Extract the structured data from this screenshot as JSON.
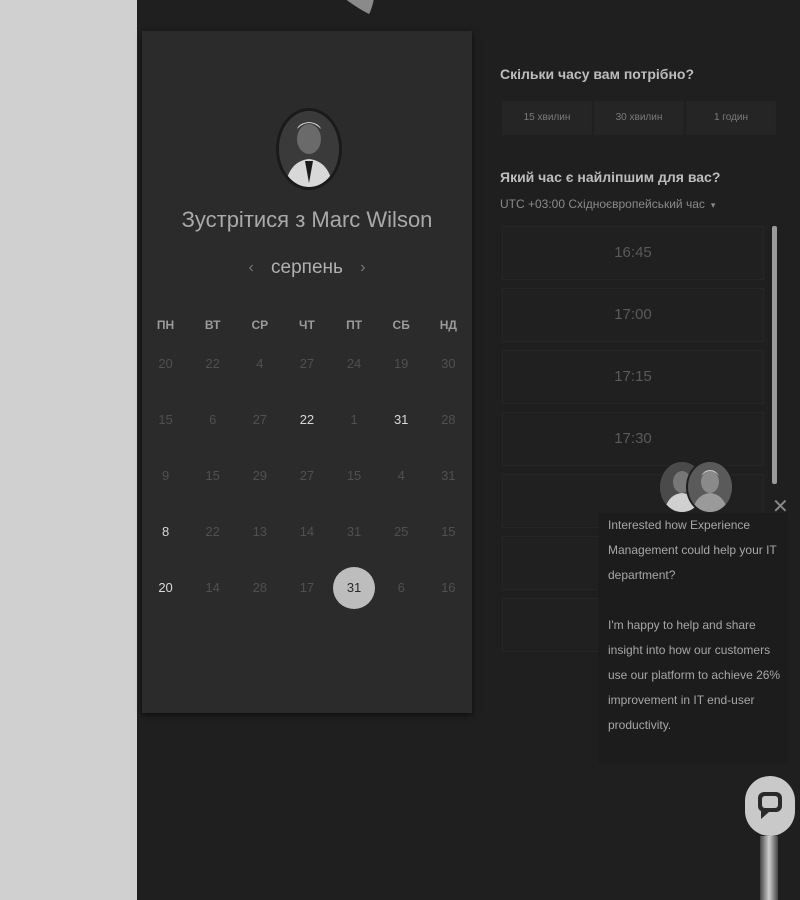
{
  "header": {},
  "calendar": {
    "title": "Зустрітися з Marc Wilson",
    "month": "серпень",
    "prev_icon": "chevron-left-icon",
    "next_icon": "chevron-right-icon",
    "weekdays": [
      "ПН",
      "ВТ",
      "СР",
      "ЧТ",
      "ПТ",
      "СБ",
      "НД"
    ],
    "weeks": [
      [
        "20",
        "22",
        "4",
        "27",
        "24",
        "19",
        "30"
      ],
      [
        "15",
        "6",
        "27",
        "22",
        "1",
        "31",
        "28"
      ],
      [
        "9",
        "15",
        "29",
        "27",
        "15",
        "4",
        "31"
      ],
      [
        "8",
        "22",
        "13",
        "14",
        "31",
        "25",
        "15"
      ],
      [
        "20",
        "14",
        "28",
        "17",
        "31",
        "6",
        "16"
      ]
    ],
    "active_days": [
      [
        1,
        3
      ],
      [
        1,
        5
      ],
      [
        3,
        0
      ],
      [
        4,
        0
      ]
    ],
    "selected_day": [
      4,
      4
    ]
  },
  "booking": {
    "duration_question": "Скільки часу вам потрібно?",
    "durations": [
      "15 хвилин",
      "30 хвилин",
      "1 годин"
    ],
    "time_question": "Який час є найліпшим для вас?",
    "timezone": "UTC +03:00 Східноєвропейський час",
    "times": [
      "16:45",
      "17:00",
      "17:15",
      "17:30",
      "",
      "",
      ""
    ]
  },
  "chat": {
    "message_p1": "Interested how Experience Management could help your IT department?",
    "message_p2": "I'm happy to help and share insight into how our customers use our platform to achieve 26% improvement in IT end-user productivity.",
    "close_icon": "close-icon",
    "fab_icon": "chat-bubble-icon"
  },
  "colors": {
    "background": "#1f1f1f",
    "card": "#2b2b2b",
    "gutter": "#d0d0d0",
    "selected_day": "#bdbdbd"
  }
}
